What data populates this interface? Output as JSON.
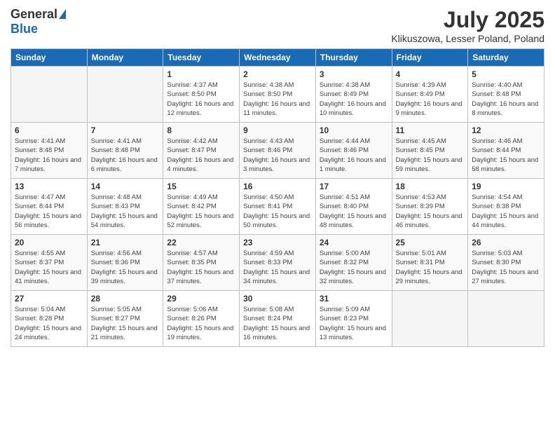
{
  "logo": {
    "general": "General",
    "blue": "Blue"
  },
  "header": {
    "title": "July 2025",
    "subtitle": "Klikuszowa, Lesser Poland, Poland"
  },
  "weekdays": [
    "Sunday",
    "Monday",
    "Tuesday",
    "Wednesday",
    "Thursday",
    "Friday",
    "Saturday"
  ],
  "weeks": [
    [
      {
        "day": "",
        "info": ""
      },
      {
        "day": "",
        "info": ""
      },
      {
        "day": "1",
        "info": "Sunrise: 4:37 AM\nSunset: 8:50 PM\nDaylight: 16 hours\nand 12 minutes."
      },
      {
        "day": "2",
        "info": "Sunrise: 4:38 AM\nSunset: 8:50 PM\nDaylight: 16 hours\nand 11 minutes."
      },
      {
        "day": "3",
        "info": "Sunrise: 4:38 AM\nSunset: 8:49 PM\nDaylight: 16 hours\nand 10 minutes."
      },
      {
        "day": "4",
        "info": "Sunrise: 4:39 AM\nSunset: 8:49 PM\nDaylight: 16 hours\nand 9 minutes."
      },
      {
        "day": "5",
        "info": "Sunrise: 4:40 AM\nSunset: 8:48 PM\nDaylight: 16 hours\nand 8 minutes."
      }
    ],
    [
      {
        "day": "6",
        "info": "Sunrise: 4:41 AM\nSunset: 8:48 PM\nDaylight: 16 hours\nand 7 minutes."
      },
      {
        "day": "7",
        "info": "Sunrise: 4:41 AM\nSunset: 8:48 PM\nDaylight: 16 hours\nand 6 minutes."
      },
      {
        "day": "8",
        "info": "Sunrise: 4:42 AM\nSunset: 8:47 PM\nDaylight: 16 hours\nand 4 minutes."
      },
      {
        "day": "9",
        "info": "Sunrise: 4:43 AM\nSunset: 8:46 PM\nDaylight: 16 hours\nand 3 minutes."
      },
      {
        "day": "10",
        "info": "Sunrise: 4:44 AM\nSunset: 8:46 PM\nDaylight: 16 hours\nand 1 minute."
      },
      {
        "day": "11",
        "info": "Sunrise: 4:45 AM\nSunset: 8:45 PM\nDaylight: 15 hours\nand 59 minutes."
      },
      {
        "day": "12",
        "info": "Sunrise: 4:46 AM\nSunset: 8:44 PM\nDaylight: 15 hours\nand 58 minutes."
      }
    ],
    [
      {
        "day": "13",
        "info": "Sunrise: 4:47 AM\nSunset: 8:44 PM\nDaylight: 15 hours\nand 56 minutes."
      },
      {
        "day": "14",
        "info": "Sunrise: 4:48 AM\nSunset: 8:43 PM\nDaylight: 15 hours\nand 54 minutes."
      },
      {
        "day": "15",
        "info": "Sunrise: 4:49 AM\nSunset: 8:42 PM\nDaylight: 15 hours\nand 52 minutes."
      },
      {
        "day": "16",
        "info": "Sunrise: 4:50 AM\nSunset: 8:41 PM\nDaylight: 15 hours\nand 50 minutes."
      },
      {
        "day": "17",
        "info": "Sunrise: 4:51 AM\nSunset: 8:40 PM\nDaylight: 15 hours\nand 48 minutes."
      },
      {
        "day": "18",
        "info": "Sunrise: 4:53 AM\nSunset: 8:39 PM\nDaylight: 15 hours\nand 46 minutes."
      },
      {
        "day": "19",
        "info": "Sunrise: 4:54 AM\nSunset: 8:38 PM\nDaylight: 15 hours\nand 44 minutes."
      }
    ],
    [
      {
        "day": "20",
        "info": "Sunrise: 4:55 AM\nSunset: 8:37 PM\nDaylight: 15 hours\nand 41 minutes."
      },
      {
        "day": "21",
        "info": "Sunrise: 4:56 AM\nSunset: 8:36 PM\nDaylight: 15 hours\nand 39 minutes."
      },
      {
        "day": "22",
        "info": "Sunrise: 4:57 AM\nSunset: 8:35 PM\nDaylight: 15 hours\nand 37 minutes."
      },
      {
        "day": "23",
        "info": "Sunrise: 4:59 AM\nSunset: 8:33 PM\nDaylight: 15 hours\nand 34 minutes."
      },
      {
        "day": "24",
        "info": "Sunrise: 5:00 AM\nSunset: 8:32 PM\nDaylight: 15 hours\nand 32 minutes."
      },
      {
        "day": "25",
        "info": "Sunrise: 5:01 AM\nSunset: 8:31 PM\nDaylight: 15 hours\nand 29 minutes."
      },
      {
        "day": "26",
        "info": "Sunrise: 5:03 AM\nSunset: 8:30 PM\nDaylight: 15 hours\nand 27 minutes."
      }
    ],
    [
      {
        "day": "27",
        "info": "Sunrise: 5:04 AM\nSunset: 8:28 PM\nDaylight: 15 hours\nand 24 minutes."
      },
      {
        "day": "28",
        "info": "Sunrise: 5:05 AM\nSunset: 8:27 PM\nDaylight: 15 hours\nand 21 minutes."
      },
      {
        "day": "29",
        "info": "Sunrise: 5:06 AM\nSunset: 8:26 PM\nDaylight: 15 hours\nand 19 minutes."
      },
      {
        "day": "30",
        "info": "Sunrise: 5:08 AM\nSunset: 8:24 PM\nDaylight: 15 hours\nand 16 minutes."
      },
      {
        "day": "31",
        "info": "Sunrise: 5:09 AM\nSunset: 8:23 PM\nDaylight: 15 hours\nand 13 minutes."
      },
      {
        "day": "",
        "info": ""
      },
      {
        "day": "",
        "info": ""
      }
    ]
  ]
}
